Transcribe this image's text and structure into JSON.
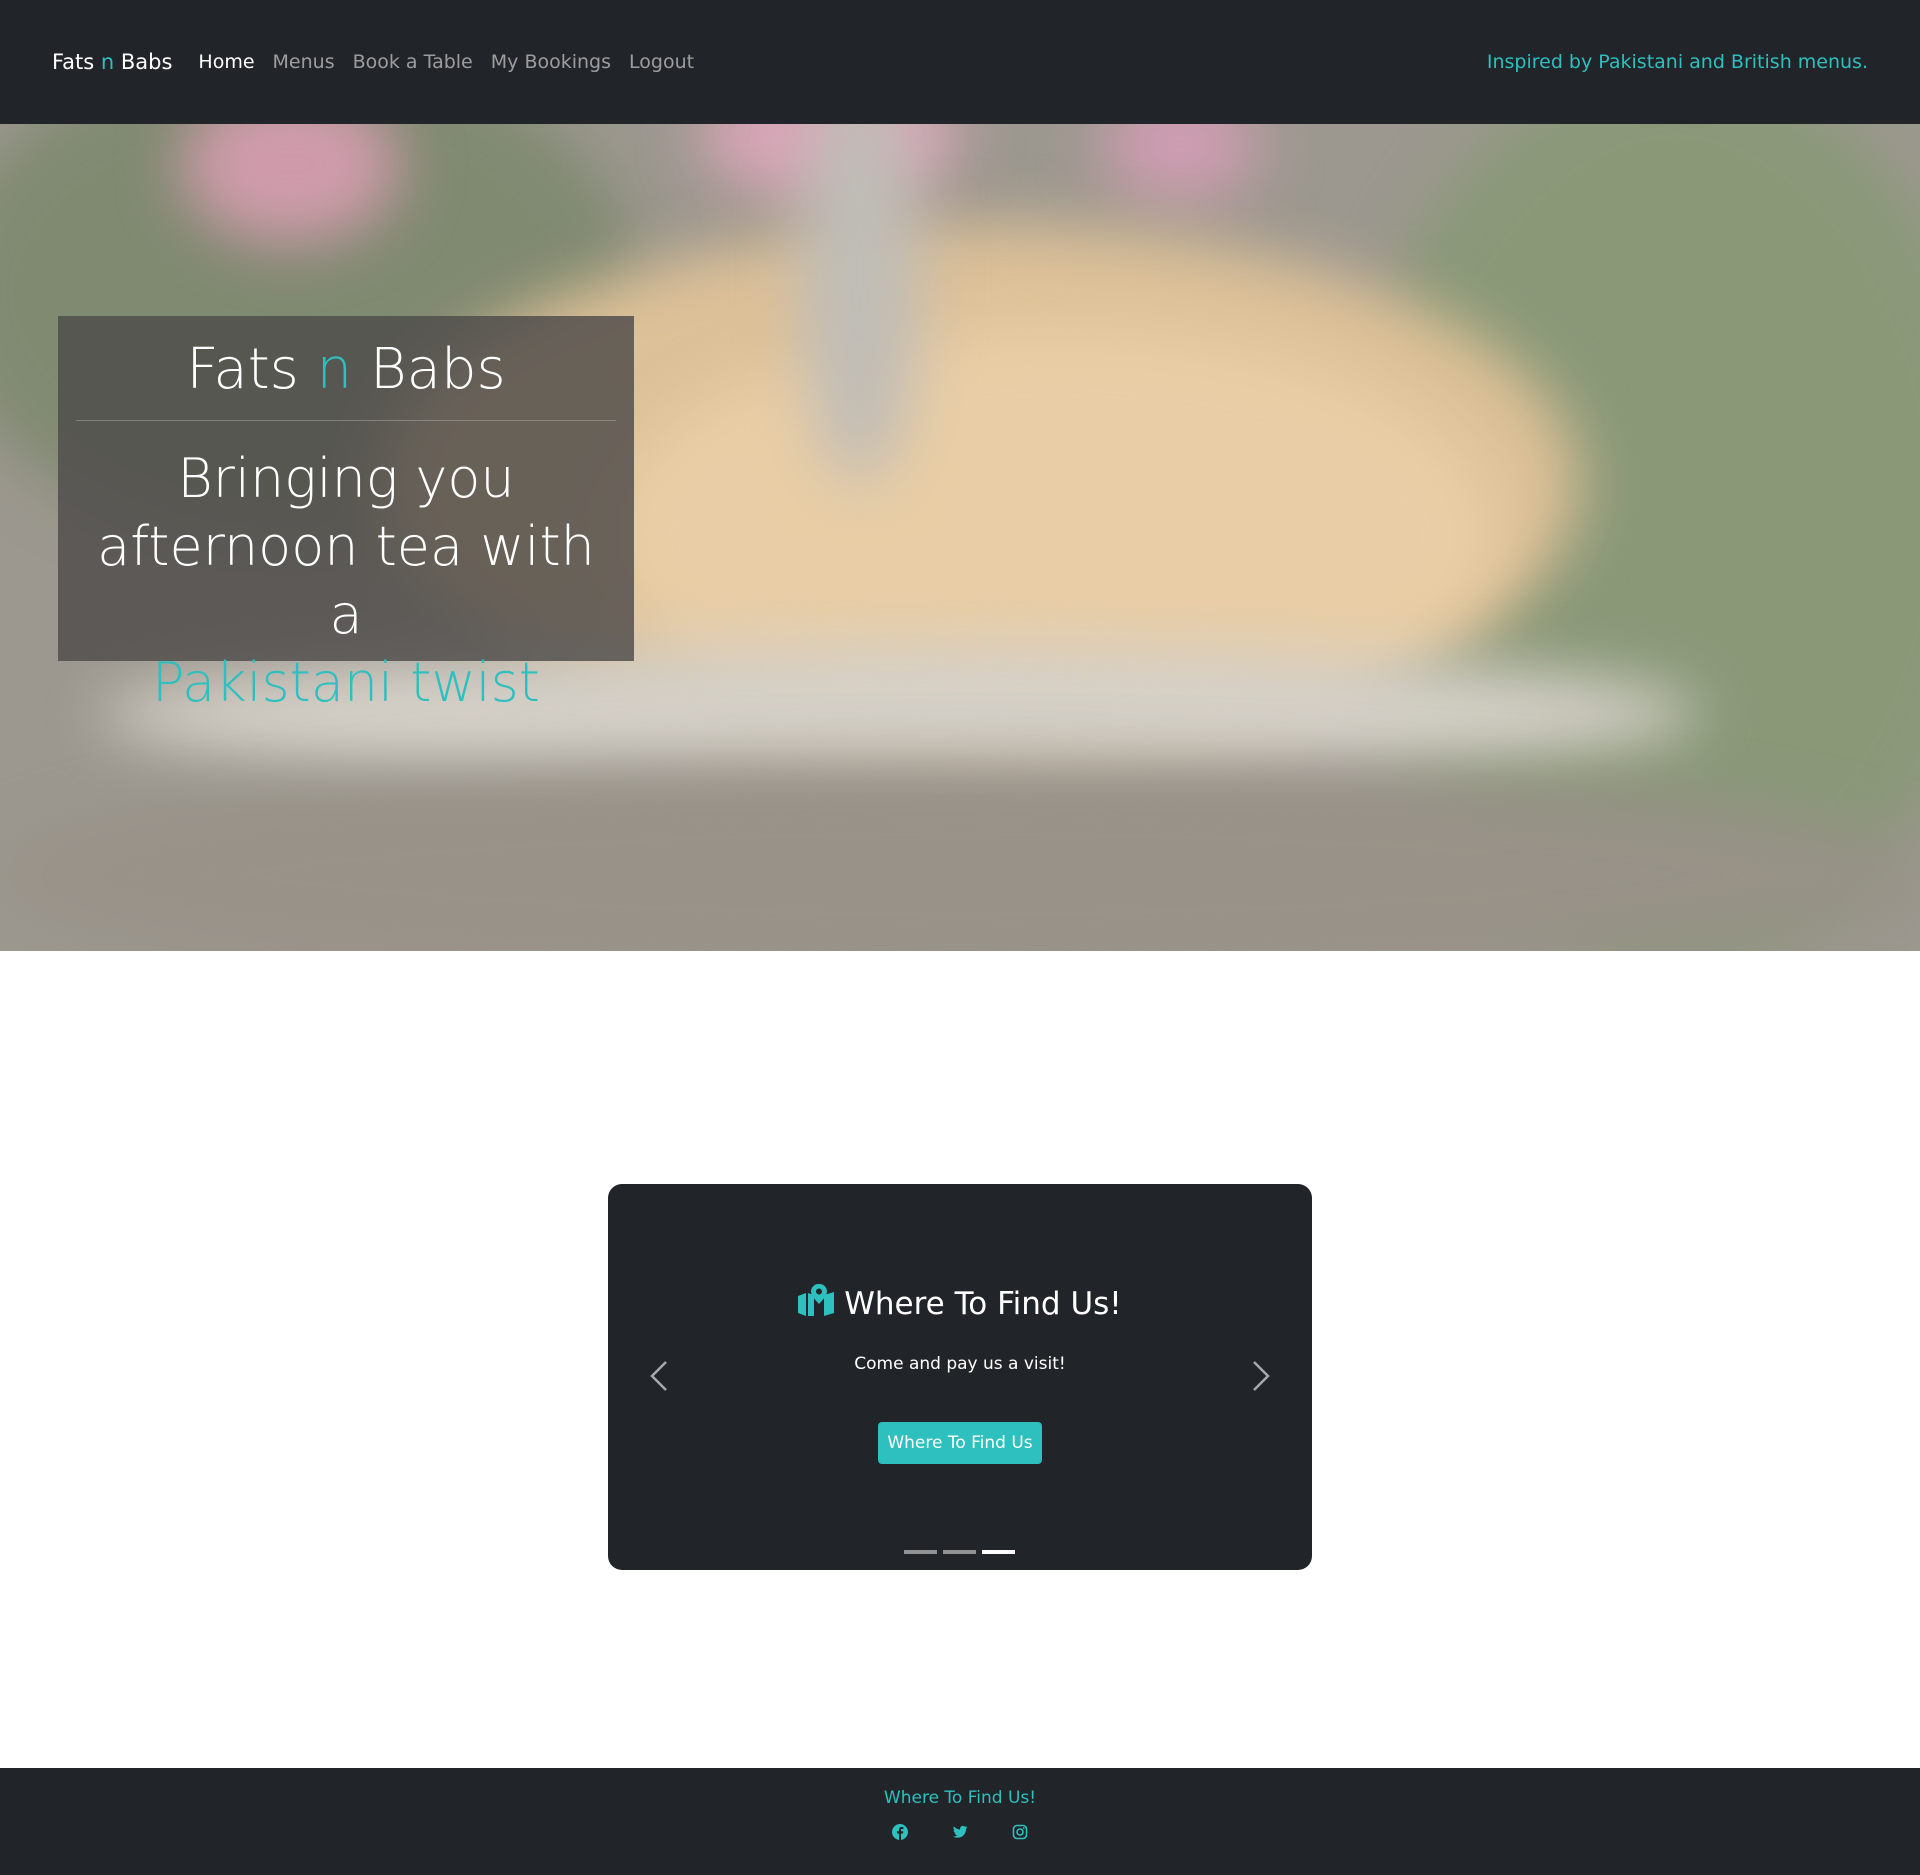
{
  "navbar": {
    "brand": {
      "part1": "Fats ",
      "accent": "n",
      "part2": " Babs"
    },
    "links": [
      {
        "label": "Home",
        "active": true
      },
      {
        "label": "Menus",
        "active": false
      },
      {
        "label": "Book a Table",
        "active": false
      },
      {
        "label": "My Bookings",
        "active": false
      },
      {
        "label": "Logout",
        "active": false
      }
    ],
    "tagline": "Inspired by Pakistani and British menus."
  },
  "hero": {
    "title": {
      "part1": "Fats ",
      "accent": "n",
      "part2": " Babs"
    },
    "subtitle_line1": "Bringing you",
    "subtitle_line2": "afternoon tea with a",
    "subtitle_accent": "Pakistani twist"
  },
  "carousel": {
    "slide_title": "Where To Find Us!",
    "slide_text": "Come and pay us a visit!",
    "slide_button": "Where To Find Us",
    "slide_icon": "map-location-icon",
    "slides_total": 3,
    "active_slide": 3
  },
  "footer": {
    "link": "Where To Find Us!",
    "socials": [
      "facebook-icon",
      "twitter-icon",
      "instagram-icon"
    ]
  },
  "colors": {
    "accent": "#2ebfbf",
    "dark": "#212529"
  }
}
